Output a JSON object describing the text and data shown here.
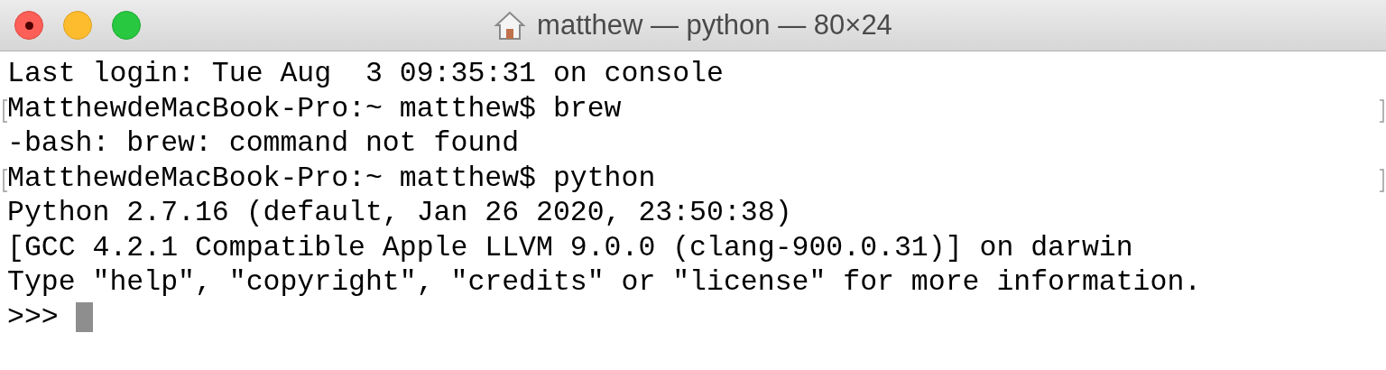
{
  "window": {
    "title": "matthew — python — 80×24"
  },
  "terminal": {
    "lines": [
      {
        "text": "Last login: Tue Aug  3 09:35:31 on console",
        "marked": false
      },
      {
        "text": "MatthewdeMacBook-Pro:~ matthew$ brew",
        "marked": true
      },
      {
        "text": "-bash: brew: command not found",
        "marked": false
      },
      {
        "text": "MatthewdeMacBook-Pro:~ matthew$ python",
        "marked": true
      },
      {
        "text": "Python 2.7.16 (default, Jan 26 2020, 23:50:38)",
        "marked": false
      },
      {
        "text": "[GCC 4.2.1 Compatible Apple LLVM 9.0.0 (clang-900.0.31)] on darwin",
        "marked": false
      },
      {
        "text": "Type \"help\", \"copyright\", \"credits\" or \"license\" for more information.",
        "marked": false
      }
    ],
    "prompt": ">>>"
  }
}
